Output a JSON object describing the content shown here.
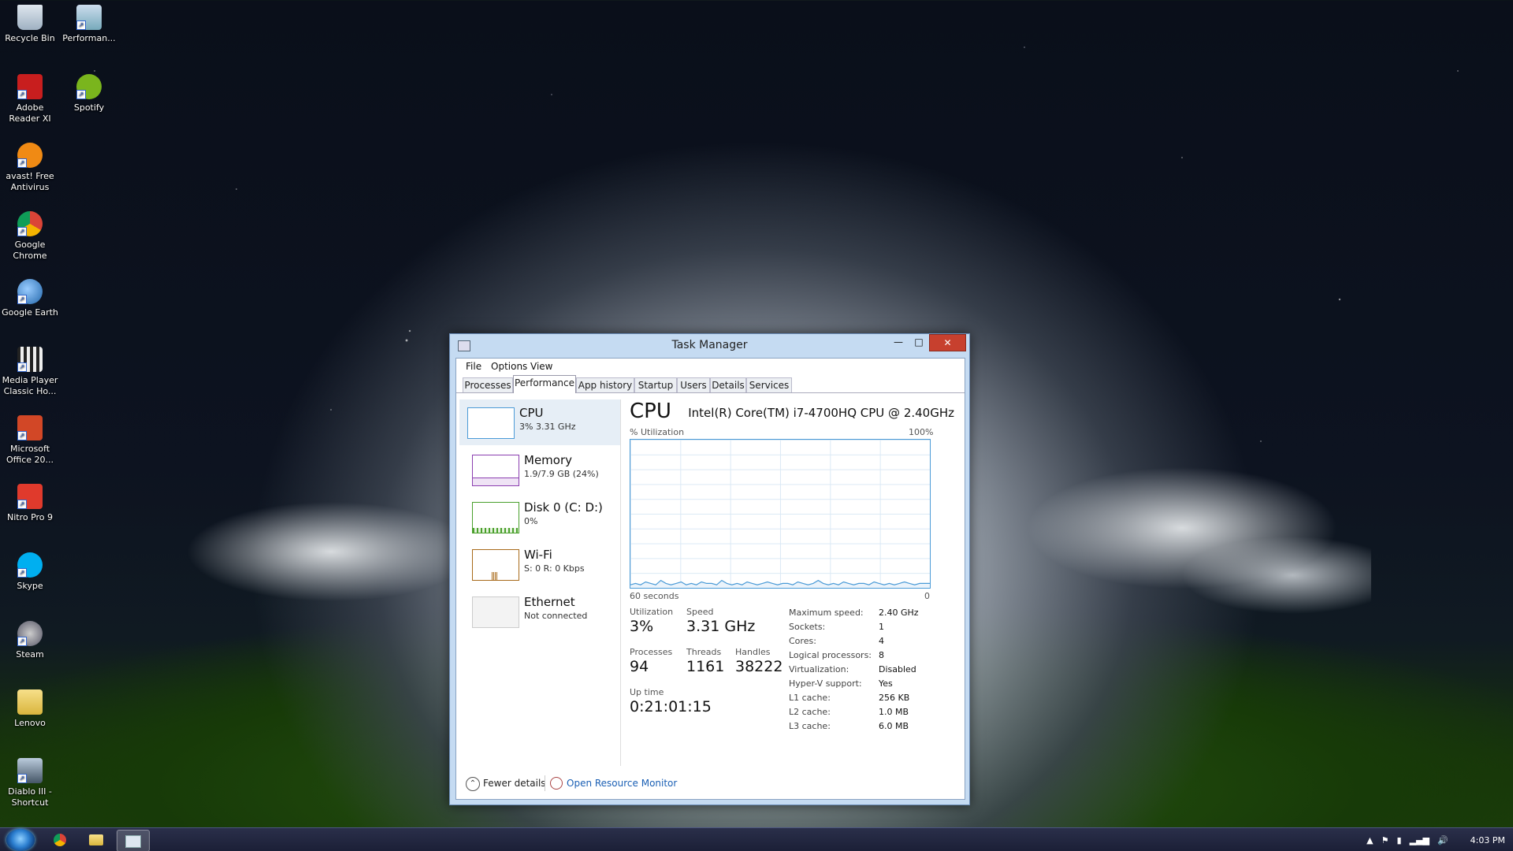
{
  "desktop": {
    "icons": [
      {
        "label": "Recycle Bin"
      },
      {
        "label": "Performan..."
      },
      {
        "label": "Adobe Reader XI"
      },
      {
        "label": "Spotify"
      },
      {
        "label": "avast! Free Antivirus"
      },
      {
        "label": "Google Chrome"
      },
      {
        "label": "Google Earth"
      },
      {
        "label": "Media Player Classic Ho..."
      },
      {
        "label": "Microsoft Office 20..."
      },
      {
        "label": "Nitro Pro 9"
      },
      {
        "label": "Skype"
      },
      {
        "label": "Steam"
      },
      {
        "label": "Lenovo"
      },
      {
        "label": "Diablo III - Shortcut"
      }
    ]
  },
  "window": {
    "title": "Task Manager",
    "controls": {
      "minimize": "—",
      "maximize": "□",
      "close": "✕"
    },
    "menu": [
      "File",
      "Options",
      "View"
    ],
    "tabs": [
      "Processes",
      "Performance",
      "App history",
      "Startup",
      "Users",
      "Details",
      "Services"
    ],
    "active_tab": "Performance"
  },
  "resources": [
    {
      "name": "CPU",
      "sub": "3% 3.31 GHz",
      "color": "#4b9bd7"
    },
    {
      "name": "Memory",
      "sub": "1.9/7.9 GB (24%)",
      "color": "#8b3fb0"
    },
    {
      "name": "Disk 0 (C: D:)",
      "sub": "0%",
      "color": "#4aa02c"
    },
    {
      "name": "Wi-Fi",
      "sub": "S: 0 R: 0 Kbps",
      "color": "#a86a1a"
    },
    {
      "name": "Ethernet",
      "sub": "Not connected",
      "color": "#bbbbbb"
    }
  ],
  "cpu": {
    "heading": "CPU",
    "model": "Intel(R) Core(TM) i7-4700HQ CPU @ 2.40GHz",
    "graph": {
      "y_label": "% Utilization",
      "y_max_label": "100%",
      "x_left_label": "60 seconds",
      "x_right_label": "0",
      "utilization_series": [
        2,
        3,
        2,
        4,
        3,
        2,
        5,
        3,
        2,
        3,
        4,
        2,
        3,
        2,
        4,
        3,
        3,
        2,
        5,
        3,
        2,
        3,
        2,
        4,
        3,
        2,
        3,
        4,
        3,
        2,
        3,
        3,
        2,
        4,
        3,
        2,
        3,
        5,
        3,
        2,
        3,
        2,
        4,
        3,
        2,
        3,
        3,
        2,
        4,
        3,
        2,
        3,
        2,
        3,
        4,
        3,
        2,
        3,
        3,
        3
      ]
    },
    "stats": {
      "utilization_label": "Utilization",
      "utilization": "3%",
      "speed_label": "Speed",
      "speed": "3.31 GHz",
      "processes_label": "Processes",
      "processes": "94",
      "threads_label": "Threads",
      "threads": "1161",
      "handles_label": "Handles",
      "handles": "38222",
      "uptime_label": "Up time",
      "uptime": "0:21:01:15"
    },
    "details": [
      {
        "k": "Maximum speed:",
        "v": "2.40 GHz"
      },
      {
        "k": "Sockets:",
        "v": "1"
      },
      {
        "k": "Cores:",
        "v": "4"
      },
      {
        "k": "Logical processors:",
        "v": "8"
      },
      {
        "k": "Virtualization:",
        "v": "Disabled"
      },
      {
        "k": "Hyper-V support:",
        "v": "Yes"
      },
      {
        "k": "L1 cache:",
        "v": "256 KB"
      },
      {
        "k": "L2 cache:",
        "v": "1.0 MB"
      },
      {
        "k": "L3 cache:",
        "v": "6.0 MB"
      }
    ]
  },
  "footer": {
    "fewer_details": "Fewer details",
    "open_resource_monitor": "Open Resource Monitor"
  },
  "taskbar": {
    "clock": "4:03 PM"
  }
}
